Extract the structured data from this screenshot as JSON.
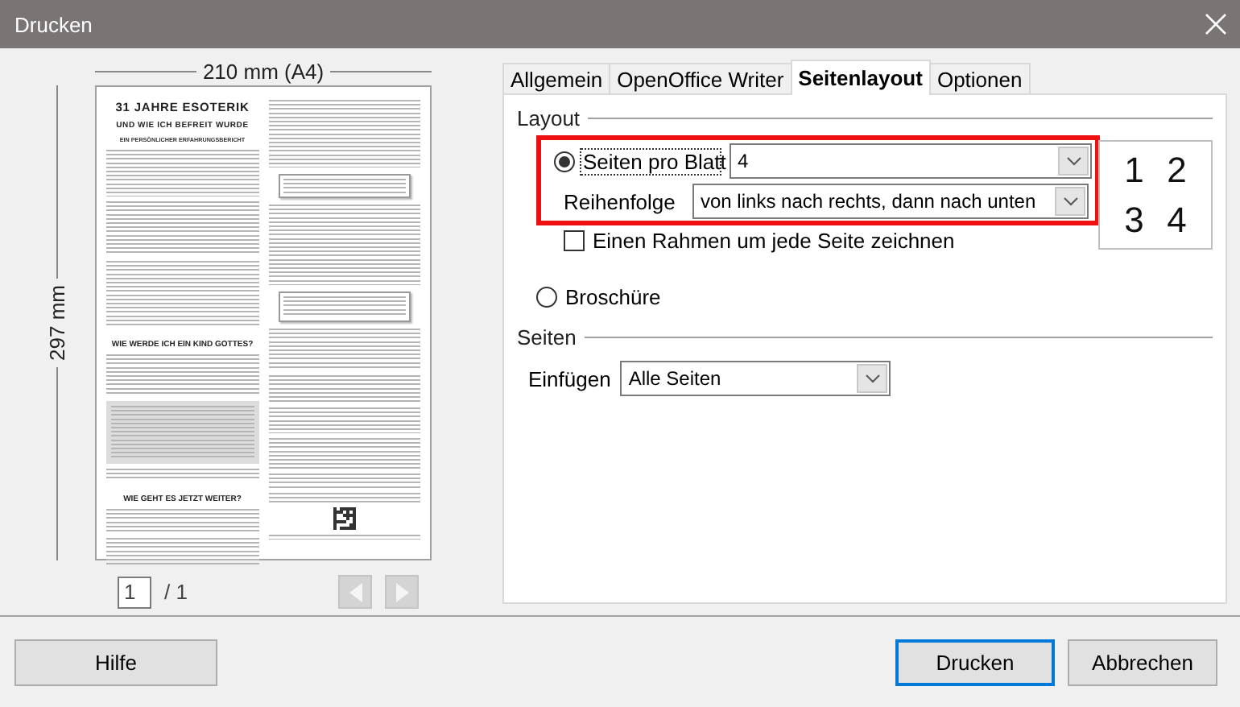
{
  "window": {
    "title": "Drucken"
  },
  "preview": {
    "width_label": "210 mm (A4)",
    "height_label": "297 mm",
    "document": {
      "title": "31 JAHRE ESOTERIK",
      "subtitle": "UND WIE ICH BEFREIT WURDE",
      "tagline": "EIN PERSÖNLICHER ERFAHRUNGSBERICHT",
      "headings": [
        "WIE WERDE ICH EIN KIND GOTTES?",
        "WIE GEHT ES JETZT WEITER?"
      ]
    },
    "page_field": {
      "value": "1"
    },
    "page_total": "/ 1",
    "prev_button": {
      "disabled": true
    },
    "next_button": {
      "disabled": true
    }
  },
  "tabs": [
    {
      "label": "Allgemein",
      "selected": false
    },
    {
      "label": "OpenOffice Writer",
      "selected": false
    },
    {
      "label": "Seitenlayout",
      "selected": true
    },
    {
      "label": "Optionen",
      "selected": false
    }
  ],
  "layout": {
    "legend": "Layout",
    "highlighted": true,
    "pages_per_sheet": {
      "label": "Seiten pro Blatt",
      "selected": true,
      "focused": true,
      "value": "4"
    },
    "order": {
      "label": "Reihenfolge",
      "value": "von links nach rechts, dann nach unten"
    },
    "border_checkbox": {
      "label": "Einen Rahmen um jede Seite zeichnen",
      "checked": false
    },
    "order_preview": [
      "1",
      "2",
      "3",
      "4"
    ],
    "brochure": {
      "label": "Broschüre",
      "selected": false
    }
  },
  "pages": {
    "legend": "Seiten",
    "include": {
      "label": "Einfügen",
      "value": "Alle Seiten"
    }
  },
  "buttons": [
    {
      "label": "Hilfe",
      "kind": "help",
      "default": false
    },
    {
      "label": "Drucken",
      "kind": "action",
      "default": true
    },
    {
      "label": "Abbrechen",
      "kind": "action",
      "default": false
    }
  ]
}
